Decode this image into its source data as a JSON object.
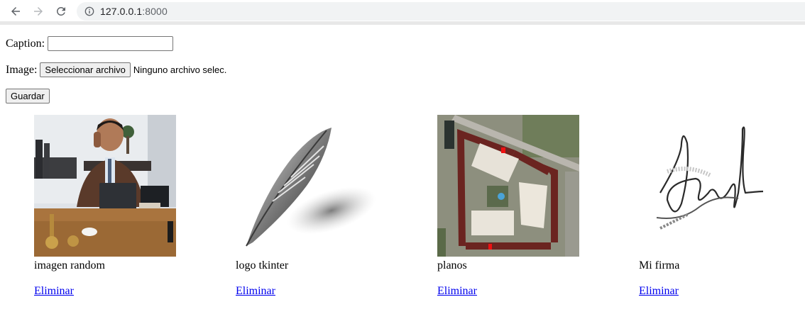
{
  "browser": {
    "url_host": "127.0.0.1",
    "url_port": ":8000"
  },
  "form": {
    "caption_label": "Caption:",
    "caption_value": "",
    "image_label": "Image:",
    "file_button_label": "Seleccionar archivo",
    "file_status": "Ninguno archivo selec.",
    "save_button_label": "Guardar"
  },
  "gallery": [
    {
      "caption": "imagen random",
      "delete_label": "Eliminar",
      "image_kind": "office-man-photo"
    },
    {
      "caption": "logo tkinter",
      "delete_label": "Eliminar",
      "image_kind": "feather-logo"
    },
    {
      "caption": "planos",
      "delete_label": "Eliminar",
      "image_kind": "aerial-map-photo"
    },
    {
      "caption": "Mi firma",
      "delete_label": "Eliminar",
      "image_kind": "signature"
    }
  ],
  "colors": {
    "link": "#0000ee",
    "omnibox_bg": "#f1f3f4"
  }
}
